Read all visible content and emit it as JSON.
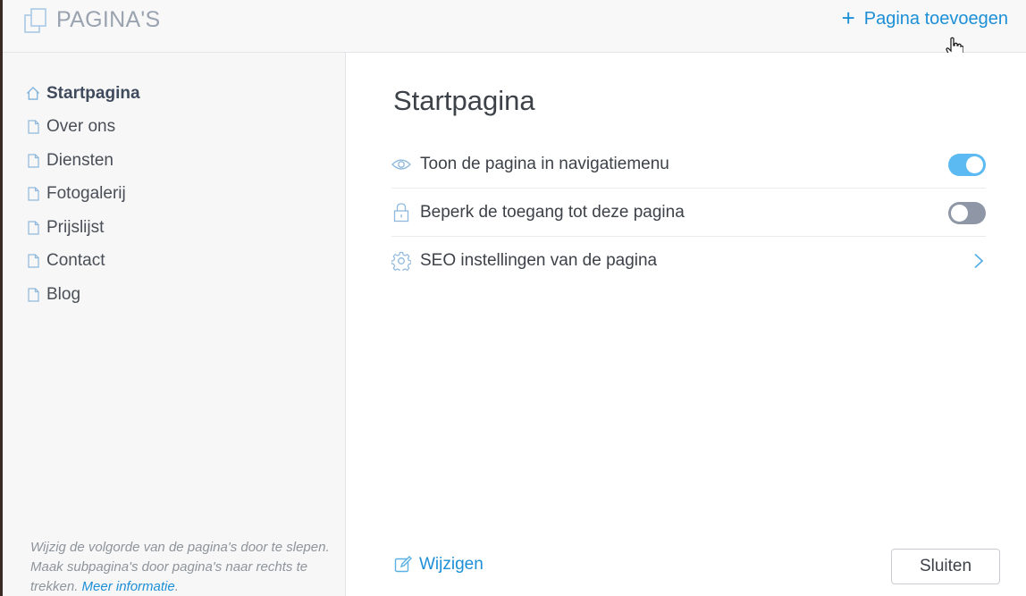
{
  "header": {
    "title": "PAGINA'S",
    "add_page_label": "Pagina toevoegen",
    "add_page_icon": "plus-icon",
    "accent_color": "#1c8fd6"
  },
  "sidebar": {
    "items": [
      {
        "label": "Startpagina",
        "icon": "home-icon",
        "active": true
      },
      {
        "label": "Over ons",
        "icon": "page-icon",
        "active": false
      },
      {
        "label": "Diensten",
        "icon": "page-icon",
        "active": false
      },
      {
        "label": "Fotogalerij",
        "icon": "page-icon",
        "active": false
      },
      {
        "label": "Prijslijst",
        "icon": "page-icon",
        "active": false
      },
      {
        "label": "Contact",
        "icon": "page-icon",
        "active": false
      },
      {
        "label": "Blog",
        "icon": "page-icon",
        "active": false
      }
    ],
    "hint_text": "Wijzig de volgorde van de pagina's door te slepen. Maak subpagina's door pagina's naar rechts te trekken.",
    "hint_link": "Meer informatie",
    "hint_suffix": "."
  },
  "main": {
    "title": "Startpagina",
    "settings": [
      {
        "label": "Toon de pagina in navigatiemenu",
        "icon": "eye-icon",
        "control": "toggle",
        "state": "on"
      },
      {
        "label": "Beperk de toegang tot deze pagina",
        "icon": "lock-icon",
        "control": "toggle",
        "state": "off"
      },
      {
        "label": "SEO instellingen van de pagina",
        "icon": "gear-icon",
        "control": "chevron"
      }
    ],
    "edit_label": "Wijzigen",
    "close_label": "Sluiten"
  }
}
